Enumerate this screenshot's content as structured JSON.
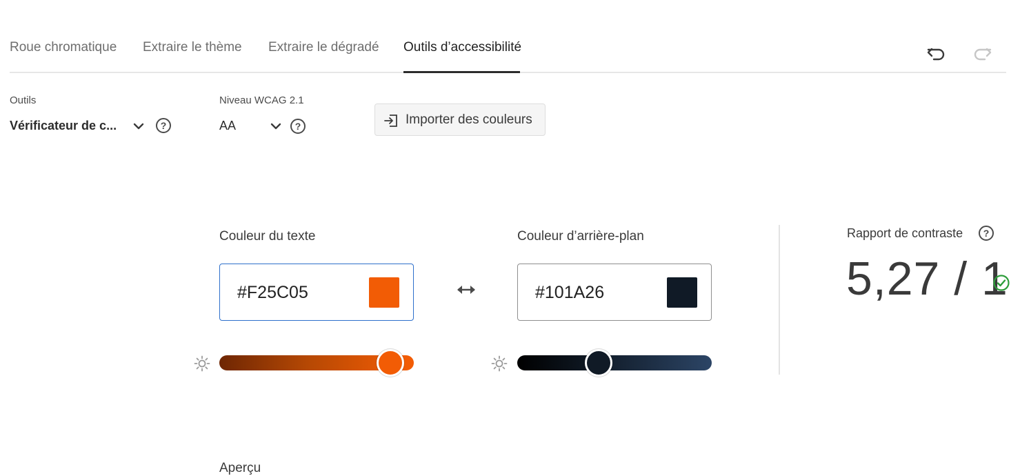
{
  "tabs": [
    {
      "label": "Roue chromatique",
      "active": false
    },
    {
      "label": "Extraire le thème",
      "active": false
    },
    {
      "label": "Extraire le dégradé",
      "active": false
    },
    {
      "label": "Outils d’accessibilité",
      "active": true
    }
  ],
  "history": {
    "undo_icon": "undo-icon",
    "redo_icon": "redo-icon"
  },
  "tools": {
    "label": "Outils",
    "value": "Vérificateur de c..."
  },
  "wcag": {
    "label": "Niveau WCAG 2.1",
    "value": "AA"
  },
  "help_glyph": "?",
  "import_button": {
    "label": "Importer des couleurs",
    "icon": "import-icon"
  },
  "text_color": {
    "label": "Couleur du texte",
    "hex": "#F25C05",
    "swatch": "#F25C05",
    "brightness": 0.92
  },
  "background_color": {
    "label": "Couleur d’arrière-plan",
    "hex": "#101A26",
    "swatch": "#101A26",
    "brightness": 0.41
  },
  "contrast": {
    "label": "Rapport de contraste",
    "ratio": "5,27 / 1",
    "pass": true
  },
  "preview": {
    "label": "Aperçu"
  },
  "colors": {
    "accent_tab": "#2c2c2c",
    "focus_border": "#2d6fcb",
    "pass_green": "#2d9d3a"
  }
}
